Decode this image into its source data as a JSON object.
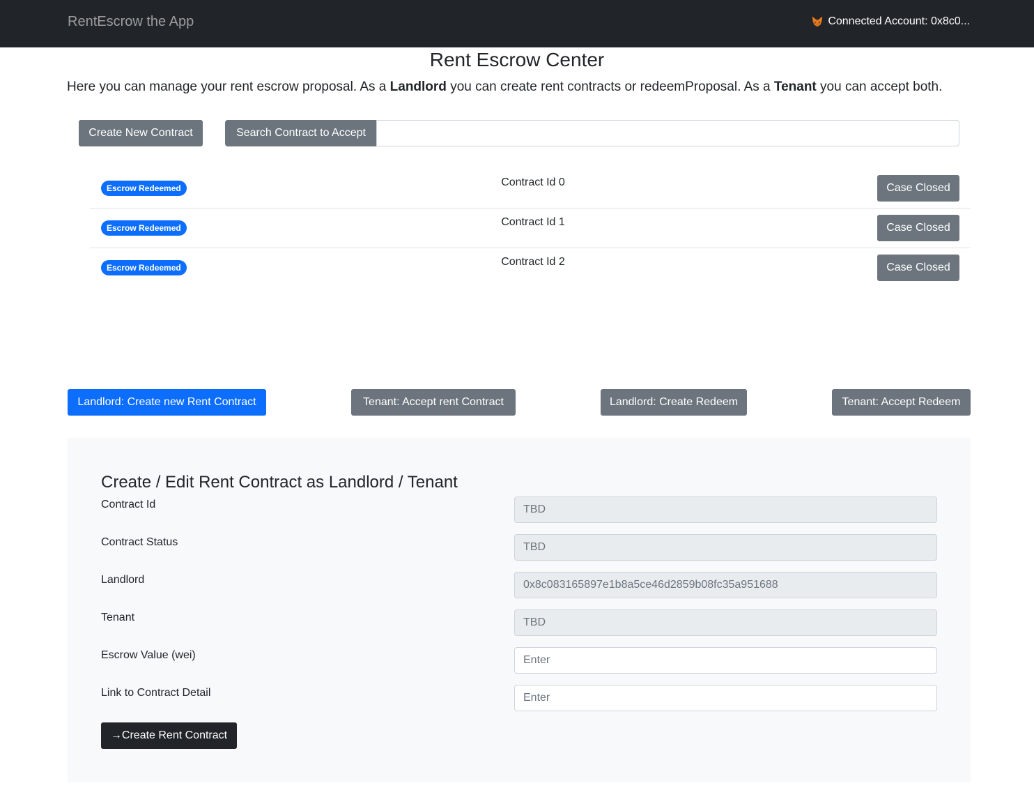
{
  "navbar": {
    "brand": "RentEscrow the App",
    "account_icon": "metamask-fox-icon",
    "account_label": "Connected Account: 0x8c0..."
  },
  "header": {
    "title": "Rent Escrow Center",
    "intro": {
      "part1": "Here you can manage your rent escrow proposal. As a ",
      "landlord": "Landlord",
      "part2": " you can create rent contracts or redeemProposal. As a ",
      "tenant": "Tenant",
      "part3": " you can accept both."
    }
  },
  "toolbar": {
    "create_label": "Create New Contract",
    "search_label": "Search Contract to Accept",
    "search_value": ""
  },
  "contracts": [
    {
      "badge": "Escrow Redeemed",
      "label": "Contract Id 0",
      "action": "Case Closed"
    },
    {
      "badge": "Escrow Redeemed",
      "label": "Contract Id 1",
      "action": "Case Closed"
    },
    {
      "badge": "Escrow Redeemed",
      "label": "Contract Id 2",
      "action": "Case Closed"
    }
  ],
  "modes": {
    "landlord_create": "Landlord: Create new Rent Contract",
    "tenant_accept": "Tenant: Accept rent Contract",
    "landlord_redeem": "Landlord: Create Redeem",
    "tenant_redeem": "Tenant: Accept Redeem",
    "active": "landlord_create"
  },
  "form": {
    "title": "Create / Edit Rent Contract as Landlord / Tenant",
    "fields": [
      {
        "label": "Contract Id",
        "value": "TBD",
        "disabled": true
      },
      {
        "label": "Contract Status",
        "value": "TBD",
        "disabled": true
      },
      {
        "label": "Landlord",
        "value": "0x8c083165897e1b8a5ce46d2859b08fc35a951688",
        "disabled": true
      },
      {
        "label": "Tenant",
        "value": "TBD",
        "disabled": true
      },
      {
        "label": "Escrow Value (wei)",
        "placeholder": "Enter",
        "disabled": false
      },
      {
        "label": "Link to Contract Detail",
        "placeholder": "Enter",
        "disabled": false
      }
    ],
    "submit_arrow": "→",
    "submit_label": "Create Rent Contract"
  },
  "colors": {
    "navbar": "#212529",
    "primary": "#0d6efd",
    "secondary": "#6c757d",
    "dark": "#212529",
    "panel": "#f8f9fa",
    "disabled_field": "#e9ecef"
  }
}
